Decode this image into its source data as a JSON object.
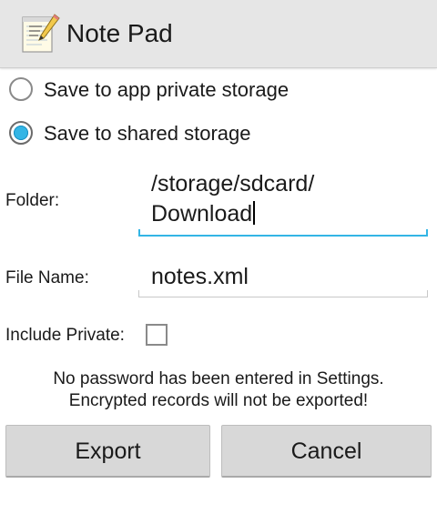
{
  "app": {
    "title": "Note Pad",
    "icon": "notepad-icon"
  },
  "storage_options": [
    {
      "label": "Save to app private storage",
      "checked": false
    },
    {
      "label": "Save to shared storage",
      "checked": true
    }
  ],
  "folder": {
    "label": "Folder:",
    "value_line1": "/storage/sdcard/",
    "value_line2": "Download"
  },
  "file_name": {
    "label": "File Name:",
    "value": "notes.xml"
  },
  "include_private": {
    "label": "Include Private:",
    "checked": false
  },
  "warning": {
    "line1": "No password has been entered in Settings.",
    "line2": "Encrypted records will not be exported!"
  },
  "buttons": {
    "export": "Export",
    "cancel": "Cancel"
  },
  "colors": {
    "accent": "#33b5e5",
    "titlebar": "#e6e6e6",
    "button": "#d8d8d8"
  }
}
